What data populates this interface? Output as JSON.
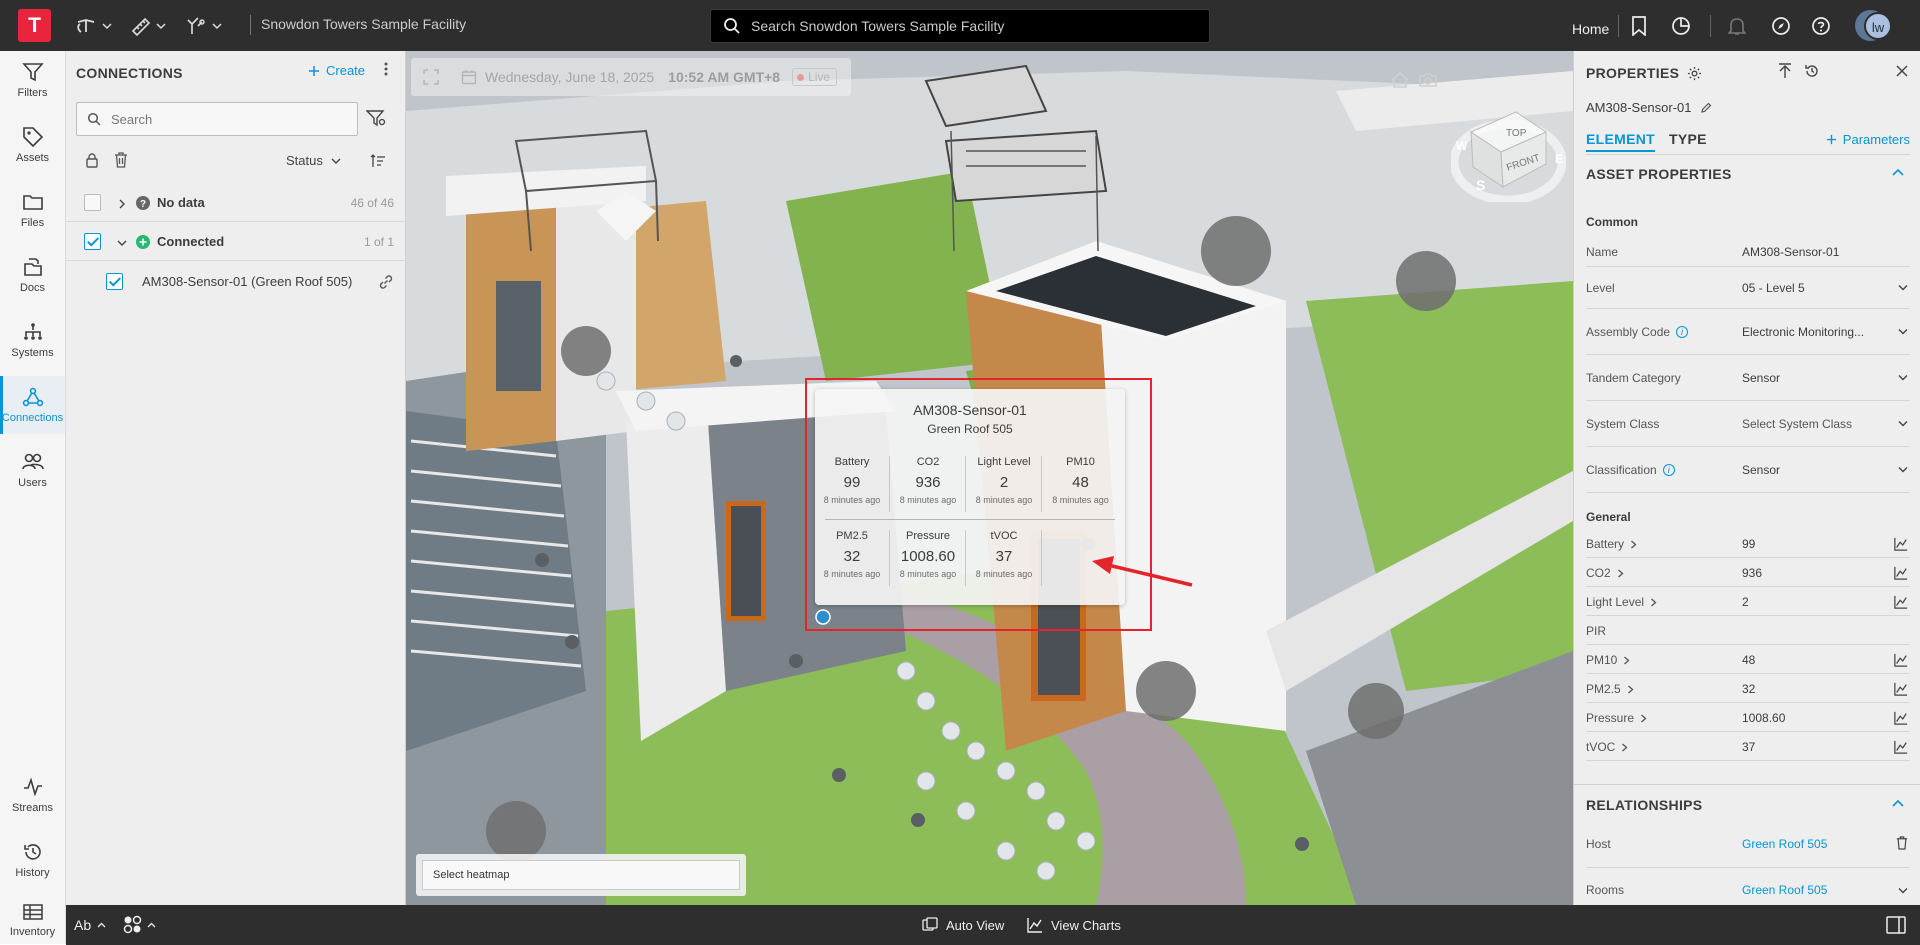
{
  "app": {
    "logo_letter": "T",
    "facility_title": "Snowdon Towers Sample Facility",
    "search_placeholder": "Search Snowdon Towers Sample Facility",
    "home_label": "Home",
    "user_initials": "lw"
  },
  "rail": {
    "items": [
      {
        "label": "Filters",
        "icon": "filter-icon"
      },
      {
        "label": "Assets",
        "icon": "tag-icon"
      },
      {
        "label": "Files",
        "icon": "folder-icon"
      },
      {
        "label": "Docs",
        "icon": "docs-icon"
      },
      {
        "label": "Systems",
        "icon": "hierarchy-icon"
      },
      {
        "label": "Connections",
        "icon": "connections-icon",
        "active": true
      },
      {
        "label": "Users",
        "icon": "users-icon"
      }
    ],
    "bottom_items": [
      {
        "label": "Streams",
        "icon": "pulse-icon"
      },
      {
        "label": "History",
        "icon": "history-icon"
      },
      {
        "label": "Inventory",
        "icon": "table-icon"
      }
    ]
  },
  "connections": {
    "title": "CONNECTIONS",
    "create_label": "Create",
    "search_placeholder": "Search",
    "status_label": "Status",
    "groups": [
      {
        "label": "No data",
        "count": "46 of 46",
        "checked": false
      },
      {
        "label": "Connected",
        "count": "1 of 1",
        "checked": true
      }
    ],
    "items": [
      {
        "label": "AM308-Sensor-01 (Green Roof 505)",
        "checked": true
      }
    ]
  },
  "viewport": {
    "date": "Wednesday, June 18, 2025",
    "time": "10:52 AM GMT+8",
    "live_label": "Live",
    "viewcube": {
      "top": "TOP",
      "front": "FRONT",
      "south": "S",
      "east": "E",
      "west": "W"
    },
    "heatmap_placeholder": "Select heatmap",
    "sensor_card": {
      "name": "AM308-Sensor-01",
      "room": "Green Roof 505",
      "metrics_row1": [
        {
          "label": "Battery",
          "value": "99",
          "time": "8 minutes ago"
        },
        {
          "label": "CO2",
          "value": "936",
          "time": "8 minutes ago"
        },
        {
          "label": "Light Level",
          "value": "2",
          "time": "8 minutes ago"
        },
        {
          "label": "PM10",
          "value": "48",
          "time": "8 minutes ago"
        }
      ],
      "metrics_row2": [
        {
          "label": "PM2.5",
          "value": "32",
          "time": "8 minutes ago"
        },
        {
          "label": "Pressure",
          "value": "1008.60",
          "time": "8 minutes ago"
        },
        {
          "label": "tVOC",
          "value": "37",
          "time": "8 minutes ago"
        }
      ]
    },
    "highlight_color": "#e3242b"
  },
  "properties": {
    "title": "PROPERTIES",
    "sensor_name": "AM308-Sensor-01",
    "tabs": [
      "ELEMENT",
      "TYPE"
    ],
    "parameters_label": "Parameters",
    "asset_section": "ASSET PROPERTIES",
    "common_label": "Common",
    "common_rows": [
      {
        "key": "Name",
        "value": "AM308-Sensor-01"
      },
      {
        "key": "Level",
        "value": "05 - Level 5",
        "dropdown": true
      },
      {
        "key": "Assembly Code",
        "value": "Electronic Monitoring...",
        "dropdown": true,
        "info": true
      },
      {
        "key": "Tandem Category",
        "value": "Sensor",
        "dropdown": true
      },
      {
        "key": "System Class",
        "value": "Select System Class",
        "dropdown": true
      },
      {
        "key": "Classification",
        "value": "Sensor",
        "dropdown": true,
        "info": true
      }
    ],
    "general_label": "General",
    "general_rows": [
      {
        "key": "Battery",
        "value": "99",
        "chart": true
      },
      {
        "key": "CO2",
        "value": "936",
        "chart": true
      },
      {
        "key": "Light Level",
        "value": "2",
        "chart": true
      },
      {
        "key": "PIR",
        "value": "",
        "chart": false
      },
      {
        "key": "PM10",
        "value": "48",
        "chart": true
      },
      {
        "key": "PM2.5",
        "value": "32",
        "chart": true
      },
      {
        "key": "Pressure",
        "value": "1008.60",
        "chart": true
      },
      {
        "key": "tVOC",
        "value": "37",
        "chart": true
      }
    ],
    "relationships_section": "RELATIONSHIPS",
    "relationship_rows": [
      {
        "key": "Host",
        "value": "Green Roof 505"
      },
      {
        "key": "Rooms",
        "value": "Green Roof 505"
      }
    ]
  },
  "bottombar": {
    "text_label": "Ab",
    "auto_view_label": "Auto View",
    "view_charts_label": "View Charts"
  },
  "colors": {
    "accent": "#0696d7",
    "brand": "#e8253c",
    "topbar": "#2e2e2e"
  }
}
